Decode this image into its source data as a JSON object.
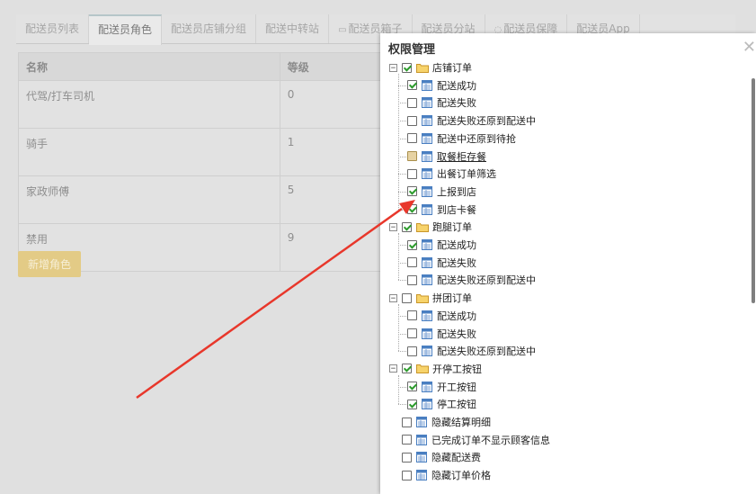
{
  "tabs": [
    {
      "label": "配送员列表",
      "active": false,
      "icon": ""
    },
    {
      "label": "配送员角色",
      "active": true,
      "icon": ""
    },
    {
      "label": "配送员店铺分组",
      "active": false,
      "icon": ""
    },
    {
      "label": "配送中转站",
      "active": false,
      "icon": ""
    },
    {
      "label": "配送员箱子",
      "active": false,
      "icon": "box-icon"
    },
    {
      "label": "配送员分站",
      "active": false,
      "icon": ""
    },
    {
      "label": "配送员保障",
      "active": false,
      "icon": "shield-icon"
    },
    {
      "label": "配送员App",
      "active": false,
      "icon": ""
    }
  ],
  "role_table": {
    "headers": [
      "名称",
      "等级"
    ],
    "rows": [
      [
        "代驾/打车司机",
        "0"
      ],
      [
        "骑手",
        "1"
      ],
      [
        "家政师傅",
        "5"
      ],
      [
        "禁用",
        "9"
      ]
    ]
  },
  "add_role_button": "新增角色",
  "modal": {
    "title": "权限管理",
    "close_icon": "close-icon",
    "tree": [
      {
        "label": "店铺订单",
        "type": "folder",
        "checked": true,
        "children": [
          {
            "label": "配送成功",
            "checked": true
          },
          {
            "label": "配送失败",
            "checked": false
          },
          {
            "label": "配送失败还原到配送中",
            "checked": false
          },
          {
            "label": "配送中还原到待抢",
            "checked": false
          },
          {
            "label": "取餐柜存餐",
            "checked": false,
            "partial": true,
            "underline": true
          },
          {
            "label": "出餐订单筛选",
            "checked": false
          },
          {
            "label": "上报到店",
            "checked": true
          },
          {
            "label": "到店卡餐",
            "checked": true
          }
        ]
      },
      {
        "label": "跑腿订单",
        "type": "folder",
        "checked": true,
        "children": [
          {
            "label": "配送成功",
            "checked": true
          },
          {
            "label": "配送失败",
            "checked": false
          },
          {
            "label": "配送失败还原到配送中",
            "checked": false
          }
        ]
      },
      {
        "label": "拼团订单",
        "type": "folder",
        "checked": false,
        "children": [
          {
            "label": "配送成功",
            "checked": false
          },
          {
            "label": "配送失败",
            "checked": false
          },
          {
            "label": "配送失败还原到配送中",
            "checked": false
          }
        ]
      },
      {
        "label": "开停工按钮",
        "type": "folder",
        "checked": true,
        "children": [
          {
            "label": "开工按钮",
            "checked": true
          },
          {
            "label": "停工按钮",
            "checked": true
          }
        ]
      },
      {
        "label": "隐藏结算明细",
        "type": "file",
        "checked": false
      },
      {
        "label": "已完成订单不显示顾客信息",
        "type": "file",
        "checked": false
      },
      {
        "label": "隐藏配送费",
        "type": "file",
        "checked": false
      },
      {
        "label": "隐藏订单价格",
        "type": "file",
        "checked": false
      }
    ]
  },
  "colors": {
    "checkmark": "#2d9b2d",
    "folder": "#f0c24b",
    "file": "#4a7fc1",
    "arrow": "#e8372b",
    "button": "#e3cb86"
  }
}
